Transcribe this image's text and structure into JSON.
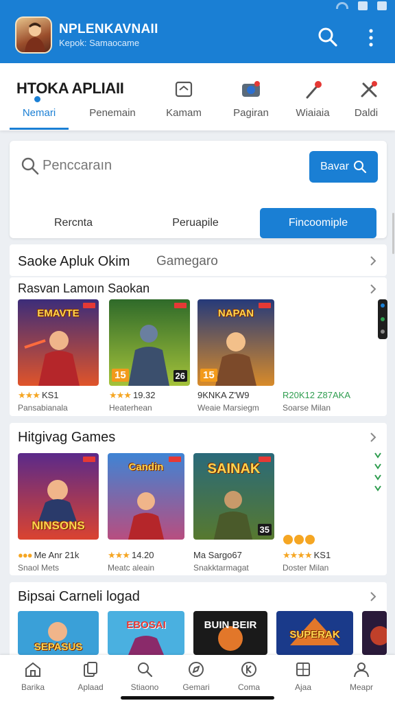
{
  "app": {
    "title": "NPLENKAVNAII",
    "subtitle": "Kepok: Samaocame"
  },
  "brand": "HTOKA  APLIAII",
  "tabs": [
    {
      "label": "Nemari",
      "icon": "brand-dot",
      "active": true
    },
    {
      "label": "Penemain",
      "icon": "none",
      "active": false
    },
    {
      "label": "Kamam",
      "icon": "folder-icon",
      "active": false
    },
    {
      "label": "Pagiran",
      "icon": "camera-icon",
      "active": false
    },
    {
      "label": "Wiaiaia",
      "icon": "pin-icon",
      "active": false
    },
    {
      "label": "Daldi",
      "icon": "tools-icon",
      "active": false
    }
  ],
  "search": {
    "placeholder": "Penccaraın",
    "button_label": "Bavar"
  },
  "filters": [
    "Rercnta",
    "Peruapile",
    "Fincoomiple"
  ],
  "category_row": {
    "title": "Saoke Apluk Okim",
    "subtitle": "Gamegaro"
  },
  "sections": [
    {
      "title": "Rasvan Lamoın Saokan",
      "items": [
        {
          "badge": "",
          "badge2": "",
          "logo": "EMAVTE",
          "rating": "KS1",
          "stars": "★★★",
          "meta": "Pansabianala"
        },
        {
          "badge": "15",
          "badge2": "26",
          "logo": "",
          "rating": "19.32",
          "stars": "★★★",
          "meta": "Heaterhean"
        },
        {
          "badge": "15",
          "badge2": "",
          "logo": "NAPAN",
          "rating": "9KNKA Z'W9",
          "stars": "",
          "meta": "Weaie Marsiegm"
        },
        {
          "badge": "",
          "badge2": "",
          "logo": "",
          "rating": "R20K12 Z87AKA",
          "stars": "",
          "meta": "Soarse Milan"
        }
      ]
    },
    {
      "title": "Hitgivag Games",
      "items": [
        {
          "badge": "",
          "badge2": "",
          "logo": "NINSONS",
          "rating": "Me Anr 21k",
          "stars": "●●●",
          "meta": "Snaol Mets"
        },
        {
          "badge": "",
          "badge2": "",
          "logo": "Candin",
          "rating": "14.20",
          "stars": "★★★",
          "meta": "Meatc aleain"
        },
        {
          "badge": "",
          "badge2": "35",
          "logo": "SAINAK",
          "rating": "Ma Sargo67",
          "stars": "",
          "meta": "Snakktarmagat"
        },
        {
          "badge": "",
          "badge2": "",
          "logo": "",
          "rating": "KS1",
          "stars": "★★★★",
          "meta": "Doster Milan"
        }
      ]
    },
    {
      "title": "Bipsai Carneli logad",
      "items": [
        {
          "logo": "SEPASUS"
        },
        {
          "logo": "EBOSAI"
        },
        {
          "logo": "BUIN BEIR"
        },
        {
          "logo": "SUPERAK"
        }
      ]
    }
  ],
  "bottom_nav": [
    {
      "label": "Barika",
      "icon": "home-icon"
    },
    {
      "label": "Aplaad",
      "icon": "copy-icon"
    },
    {
      "label": "Stiaono",
      "icon": "search-icon"
    },
    {
      "label": "Gemari",
      "icon": "explore-icon"
    },
    {
      "label": "Coma",
      "icon": "k-icon"
    },
    {
      "label": "Ajaa",
      "icon": "grid-icon"
    },
    {
      "label": "Meapr",
      "icon": "user-icon"
    }
  ],
  "colors": {
    "accent": "#1a7fd4",
    "star": "#f5a623"
  }
}
